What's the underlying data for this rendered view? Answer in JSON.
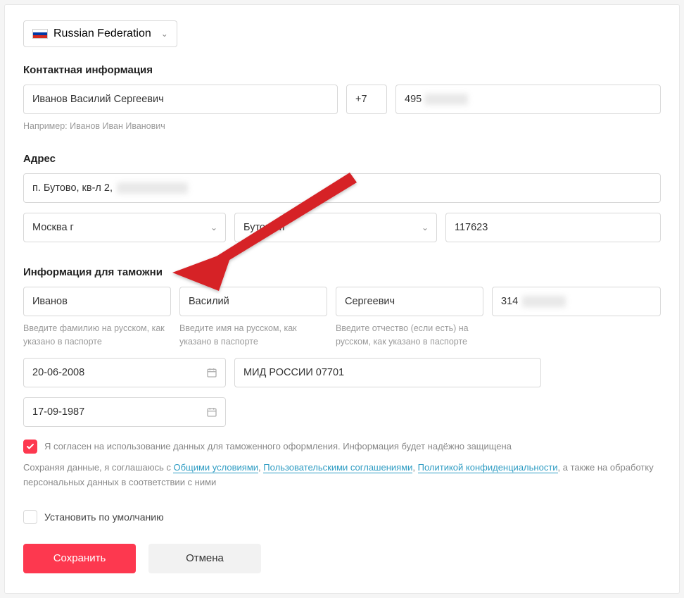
{
  "country": {
    "label": "Russian Federation"
  },
  "sections": {
    "contact_title": "Контактная информация",
    "address_title": "Адрес",
    "customs_title": "Информация для таможни"
  },
  "contact": {
    "full_name": "Иванов Василий Сергеевич",
    "name_hint": "Например: Иванов Иван Иванович",
    "phone_prefix": "+7",
    "phone_number": "495",
    "phone_number_masked": "██████"
  },
  "address": {
    "street_visible": "п. Бутово, кв-л 2,",
    "street_masked": "████ ███ ██",
    "city": "Москва г",
    "district": "Бутово п",
    "postcode": "117623"
  },
  "customs": {
    "last_name": "Иванов",
    "last_name_hint": "Введите фамилию на русском, как указано в паспорте",
    "first_name": "Василий",
    "first_name_hint": "Введите имя на русском, как указано в паспорте",
    "patronymic": "Сергеевич",
    "patronymic_hint": "Введите отчество (если есть) на русском, как указано в паспорте",
    "inn_visible": "314",
    "inn_masked": "██████",
    "date1": "20-06-2008",
    "issuer": "МИД РОССИИ 07701",
    "date2": "17-09-1987"
  },
  "consent": {
    "label": "Я согласен на использование данных для таможенного оформления. Информация будет надёжно защищена"
  },
  "legal": {
    "prefix": "Сохраняя данные, я соглашаюсь с ",
    "link1": "Общими условиями",
    "sep1": ", ",
    "link2": "Пользовательскими соглашениями",
    "sep2": ", ",
    "link3": "Политикой конфиденциальности",
    "suffix": ", а также на обработку персональных данных в соответствии с ними"
  },
  "default_checkbox": {
    "label": "Установить по умолчанию"
  },
  "buttons": {
    "save": "Сохранить",
    "cancel": "Отмена"
  }
}
